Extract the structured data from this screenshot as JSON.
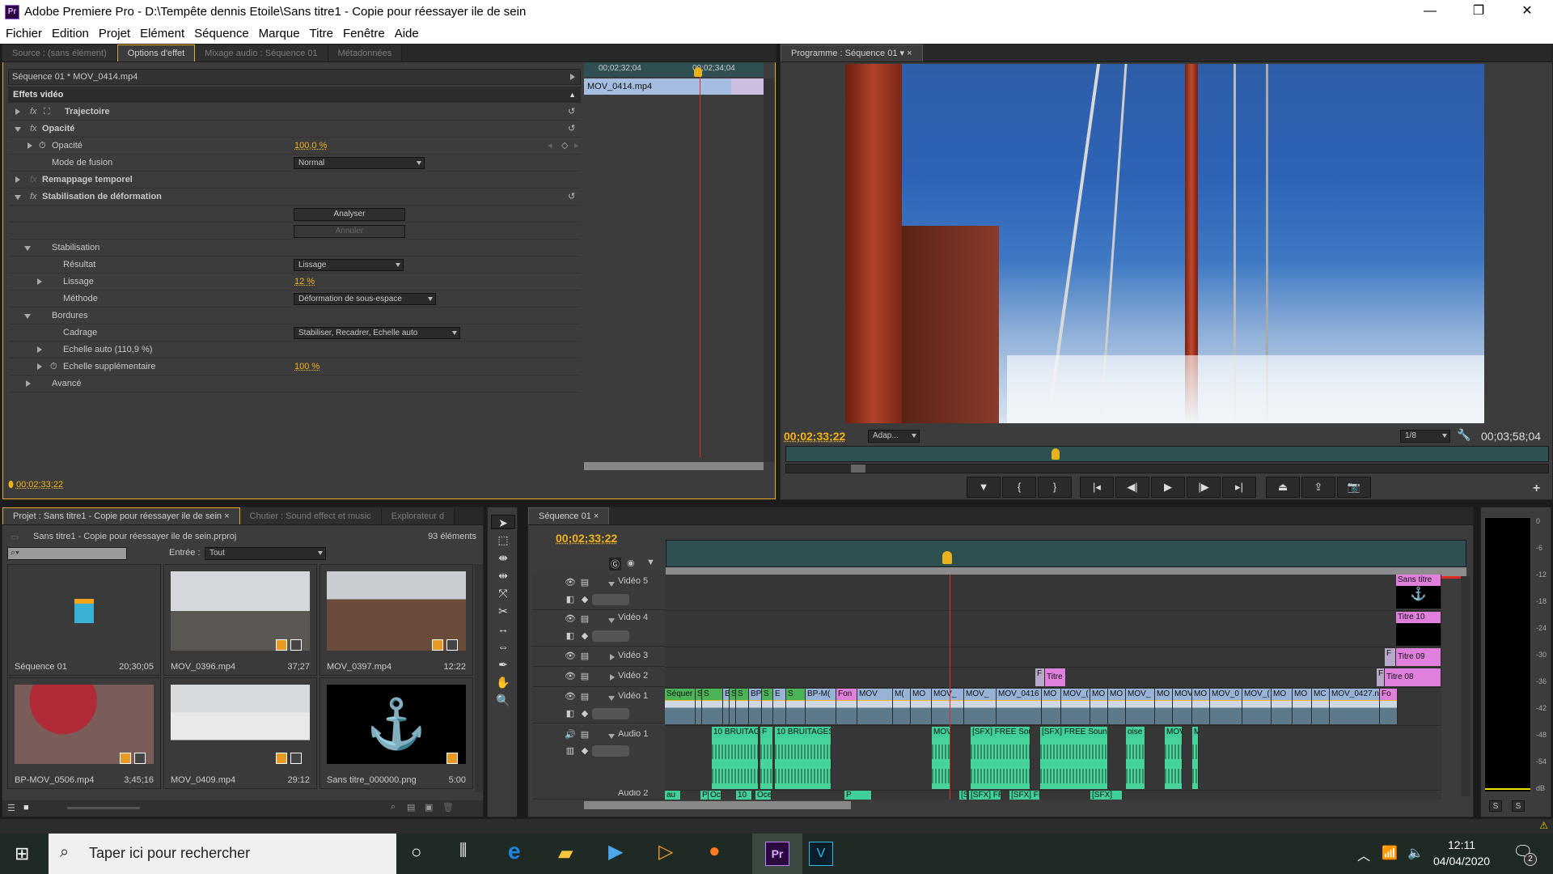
{
  "window": {
    "title": "Adobe Premiere Pro - D:\\Tempête dennis Etoile\\Sans titre1 - Copie pour réessayer ile de sein",
    "app_icon": "Pr",
    "controls": {
      "minimize": "—",
      "maximize": "❐",
      "close": "✕"
    }
  },
  "menu": [
    "Fichier",
    "Edition",
    "Projet",
    "Elément",
    "Séquence",
    "Marque",
    "Titre",
    "Fenêtre",
    "Aide"
  ],
  "source_panel": {
    "tabs": [
      "Source : (sans élément)",
      "Options d'effet",
      "Mixage audio : Séquence 01",
      "Métadonnées"
    ],
    "active_tab": 1,
    "clip_header": "Séquence 01 * MOV_0414.mp4",
    "section": "Effets vidéo",
    "effects": {
      "trajectoire": "Trajectoire",
      "opacite": "Opacité",
      "opacite_param": "Opacité",
      "opacite_value": "100,0 %",
      "mode_fusion": "Mode de fusion",
      "mode_fusion_value": "Normal",
      "remappage": "Remappage temporel",
      "stabilisation_deformation": "Stabilisation de déformation",
      "analyser": "Analyser",
      "annuler": "Annuler",
      "stabilisation": "Stabilisation",
      "resultat": "Résultat",
      "resultat_value": "Lissage",
      "lissage": "Lissage",
      "lissage_value": "12 %",
      "methode": "Méthode",
      "methode_value": "Déformation de sous-espace",
      "bordures": "Bordures",
      "cadrage": "Cadrage",
      "cadrage_value": "Stabiliser, Recadrer, Echelle auto",
      "echelle_auto": "Echelle auto (110,9 %)",
      "echelle_supp": "Echelle supplémentaire",
      "echelle_supp_value": "100 %",
      "avance": "Avancé"
    },
    "mini_timeline": {
      "tc_start": "00;02;32;04",
      "tc_end": "00;02;34;04",
      "clip": "MOV_0414.mp4"
    },
    "current_time": "00;02;33;22"
  },
  "program_panel": {
    "tab": "Programme : Séquence 01",
    "current_time": "00;02;33;22",
    "fit": "Adap...",
    "resolution": "1/8",
    "duration": "00;03;58;04",
    "controls": [
      "marker",
      "in",
      "out",
      "go-to-in",
      "step-back",
      "play",
      "step-forward",
      "go-to-out",
      "lift",
      "extract",
      "export-frame"
    ],
    "add": "+"
  },
  "project_panel": {
    "tabs": [
      "Projet : Sans titre1 - Copie pour réessayer ile de sein",
      "Chutier : Sound effect et music",
      "Explorateur d"
    ],
    "project_file": "Sans titre1 - Copie pour réessayer ile de sein.prproj",
    "count": "93 éléments",
    "search_placeholder": "",
    "entry_label": "Entrée :",
    "entry_value": "Tout",
    "items": [
      {
        "name": "Séquence 01",
        "duration": "20;30;05"
      },
      {
        "name": "MOV_0396.mp4",
        "duration": "37;27"
      },
      {
        "name": "MOV_0397.mp4",
        "duration": "12:22"
      },
      {
        "name": "BP-MOV_0506.mp4",
        "duration": "3;45;16"
      },
      {
        "name": "MOV_0409.mp4",
        "duration": "29:12"
      },
      {
        "name": "Sans titre_000000.png",
        "duration": "5:00"
      }
    ]
  },
  "timeline": {
    "tab": "Séquence 01",
    "current_time": "00;02;33;22",
    "tracks": {
      "v5": "Vidéo 5",
      "v4": "Vidéo 4",
      "v3": "Vidéo 3",
      "v2": "Vidéo 2",
      "v1": "Vidéo 1",
      "a1": "Audio 1",
      "a2": "Audio 2"
    },
    "clips": {
      "v5": [
        "Sans titre"
      ],
      "v4": [
        "Titre 10"
      ],
      "v3": [
        "F",
        "Titre 09"
      ],
      "v2": [
        "F",
        "Titre",
        "F",
        "Titre 08"
      ],
      "v1": [
        "Séquer",
        "Séque",
        "S",
        "B",
        "S",
        "S",
        "BP",
        "S",
        "E",
        "S",
        "BP-M(",
        "Fon",
        "MOV",
        "M(",
        "MO",
        "MOV_",
        "MOV_",
        "MOV_0416",
        "MO",
        "MOV_(",
        "MO",
        "MO",
        "MOV_",
        "MO",
        "MOV",
        "MO",
        "MOV_0",
        "MOV_(",
        "MO",
        "MO",
        "MC",
        "MOV_0427.n",
        "Fo"
      ],
      "a1": [
        "10 BRUITAGI",
        "F",
        "10 BRUITAGES",
        "MOV_",
        "[SFX] FREE Soun",
        "[SFX] FREE Sound E",
        "oise",
        "MOV",
        "M"
      ],
      "a2": [
        "au",
        "Pe",
        "Oc",
        "10",
        "Ocean",
        "P",
        "[SFX] FR",
        "[SFX] FREE Sou",
        "[SFX] FI",
        "[SFX]"
      ]
    }
  },
  "audio_meter": {
    "scale": [
      "0",
      "-6",
      "-12",
      "-18",
      "-24",
      "-30",
      "-36",
      "-42",
      "-48",
      "-54",
      "dB"
    ],
    "solo": [
      "S",
      "S"
    ]
  },
  "taskbar": {
    "search_placeholder": "Taper ici pour rechercher",
    "time": "12:11",
    "date": "04/04/2020",
    "notifications": "2"
  }
}
